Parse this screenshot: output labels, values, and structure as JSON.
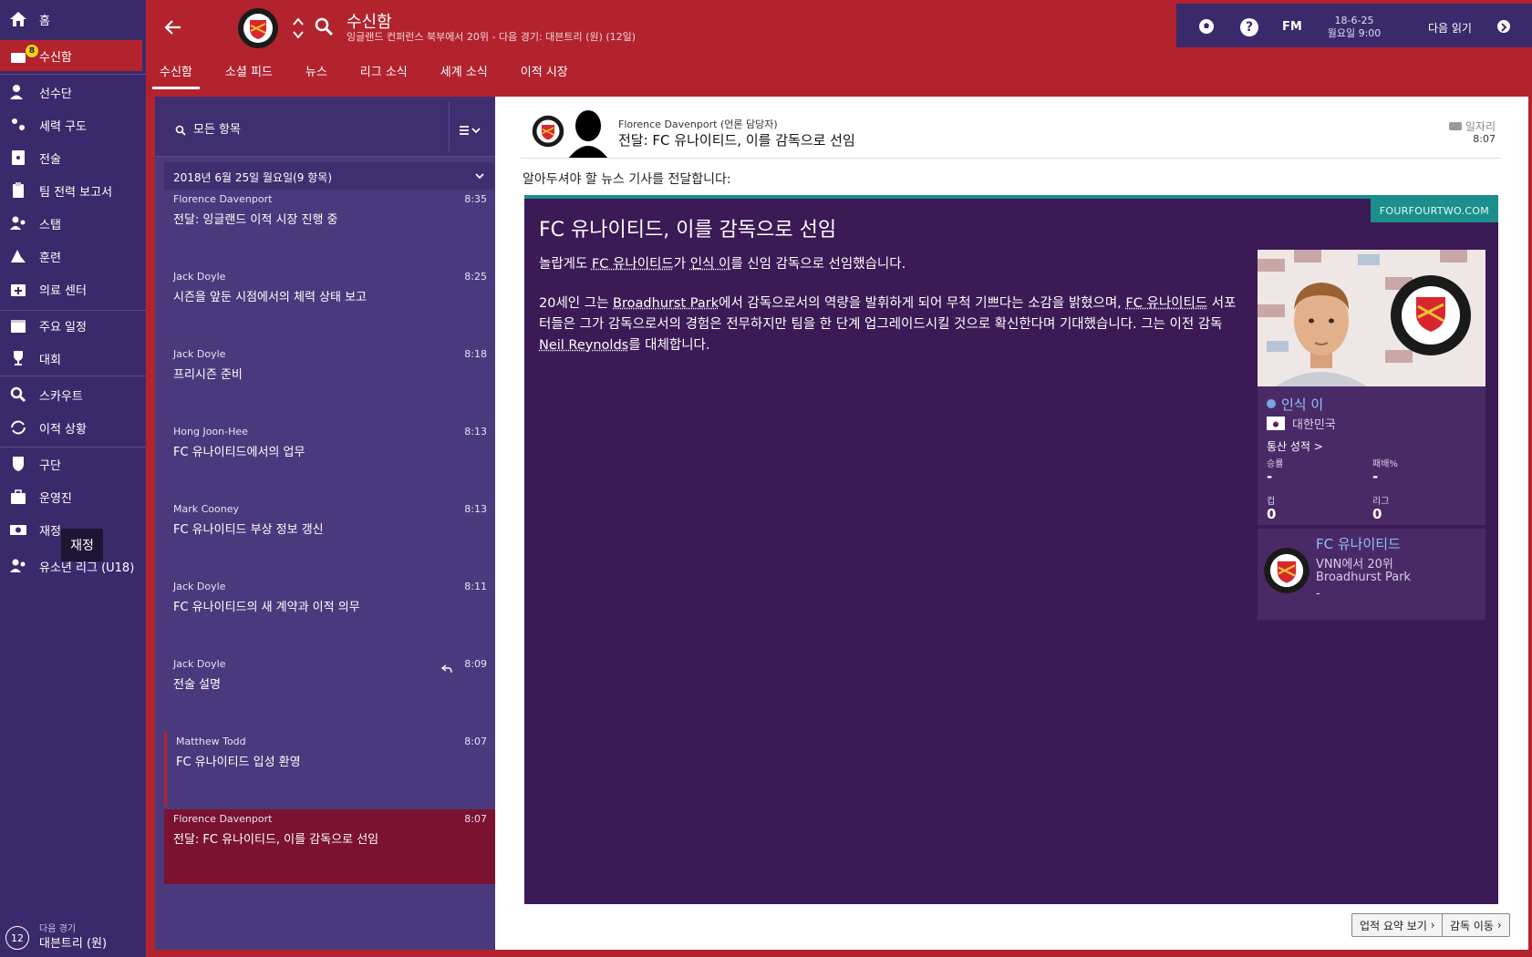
{
  "sidebar": {
    "items": [
      {
        "label": "홈",
        "icon": "home-icon"
      },
      {
        "label": "수신함",
        "icon": "inbox-icon",
        "badge": "8"
      },
      {
        "label": "선수단",
        "icon": "squad-icon"
      },
      {
        "label": "세력 구도",
        "icon": "dynamics-icon"
      },
      {
        "label": "전술",
        "icon": "tactics-icon"
      },
      {
        "label": "팀 전력 보고서",
        "icon": "report-icon"
      },
      {
        "label": "스탭",
        "icon": "staff-icon"
      },
      {
        "label": "훈련",
        "icon": "training-icon"
      },
      {
        "label": "의료 센터",
        "icon": "medical-icon"
      },
      {
        "label": "주요 일정",
        "icon": "calendar-icon"
      },
      {
        "label": "대회",
        "icon": "trophy-icon"
      },
      {
        "label": "스카우트",
        "icon": "scouting-icon"
      },
      {
        "label": "이적 상황",
        "icon": "transfers-icon"
      },
      {
        "label": "구단",
        "icon": "club-icon"
      },
      {
        "label": "운영진",
        "icon": "board-icon"
      },
      {
        "label": "재정",
        "icon": "finances-icon"
      },
      {
        "label": "유소년 리그 (U18)",
        "icon": "youth-icon"
      }
    ],
    "tooltip": "재정",
    "next_match": {
      "count": "12",
      "label": "다음 경기",
      "opponent": "대븐트리 (원)"
    }
  },
  "header": {
    "title": "수신함",
    "subtitle": "잉글랜드 컨퍼런스 북부에서 20위 - 다음 경기: 대븐트리 (원) (12일)",
    "tabs": [
      "수신함",
      "소셜 피드",
      "뉴스",
      "리그 소식",
      "세계 소식",
      "이적 시장"
    ]
  },
  "topbar": {
    "fm": "FM",
    "date_line1": "18-6-25",
    "date_line2": "월요일 9:00",
    "continue_label": "다음 읽기"
  },
  "inbox": {
    "search_label": "모든 항목",
    "group_label": "2018년 6월 25일 월요일(9 항목)",
    "messages": [
      {
        "from": "Florence Davenport",
        "time": "8:35",
        "subject": "전달: 잉글랜드 이적 시장 진행 중"
      },
      {
        "from": "Jack Doyle",
        "time": "8:25",
        "subject": "시즌을 앞둔 시점에서의 체력 상태 보고"
      },
      {
        "from": "Jack Doyle",
        "time": "8:18",
        "subject": "프리시즌 준비"
      },
      {
        "from": "Hong Joon-Hee",
        "time": "8:13",
        "subject": "FC 유나이티드에서의 업무"
      },
      {
        "from": "Mark Cooney",
        "time": "8:13",
        "subject": "FC 유나이티드 부상 정보 갱신"
      },
      {
        "from": "Jack Doyle",
        "time": "8:11",
        "subject": "FC 유나이티드의 새 계약과 이적 의무"
      },
      {
        "from": "Jack Doyle",
        "time": "8:09",
        "subject": "전술 설명"
      },
      {
        "from": "Matthew Todd",
        "time": "8:07",
        "subject": "FC 유나이티드 입성 환영"
      },
      {
        "from": "Florence Davenport",
        "time": "8:07",
        "subject": "전달: FC 유나이티드, 이를 감독으로 선임"
      }
    ]
  },
  "message": {
    "from": "Florence Davenport  (언론 담당자)",
    "subject": "전달: FC 유나이티드, 이를 감독으로 선임",
    "tag": "일자리",
    "time": "8:07",
    "intro": "알아두셔야 할 뉴스 기사를 전달합니다:",
    "article": {
      "source": "FOURFOURTWO.COM",
      "title": "FC 유나이티드, 이를 감독으로 선임",
      "p1_a": "놀랍게도 ",
      "p1_club": "FC 유나이티드",
      "p1_b": "가 ",
      "p1_name": "인식 이",
      "p1_c": "를 신임 감독으로 선임했습니다.",
      "p2_a": "20세인 그는 ",
      "p2_stadium": "Broadhurst Park",
      "p2_b": "에서 감독으로서의 역량을 발휘하게 되어 무척 기쁘다는 소감을 밝혔으며, ",
      "p2_club": "FC 유나이티드",
      "p2_c": " 서포터들은 그가 감독으로서의 경험은 전무하지만 팀을 한 단계 업그레이드시킬 것으로 확신한다며 기대했습니다. 그는 이전 감독 ",
      "p2_prev": "Neil Reynolds",
      "p2_d": "를 대체합니다."
    },
    "person": {
      "name": "인식 이",
      "nation": "대한민국",
      "career_label": "통산 성적 >",
      "stats": [
        {
          "label": "승률",
          "value": "-"
        },
        {
          "label": "패배%",
          "value": "-"
        },
        {
          "label": "컵",
          "value": "0"
        },
        {
          "label": "리그",
          "value": "0"
        }
      ]
    },
    "club": {
      "name": "FC 유나이티드",
      "line1": "VNN에서 20위",
      "line2": "Broadhurst Park",
      "line3": "-"
    }
  },
  "buttons": {
    "summary": "업적 요약 보기",
    "move": "감독 이동"
  },
  "colors": {
    "brand_red": "#b2232e",
    "panel_purple": "#3a2a6b",
    "article_bg": "#3b1a55",
    "accent_teal": "#1a8f8c"
  }
}
